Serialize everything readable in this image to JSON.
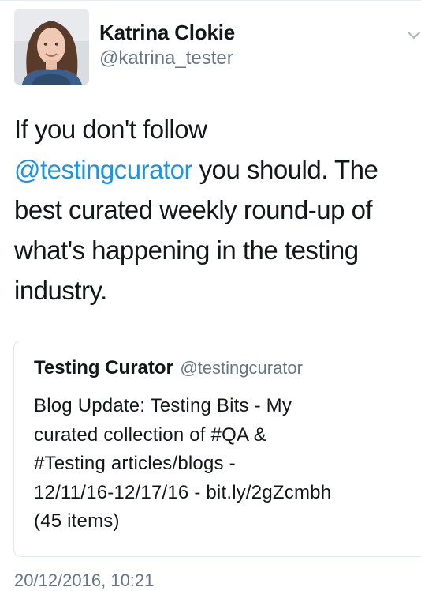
{
  "author": {
    "name": "Katrina Clokie",
    "handle": "@katrina_tester"
  },
  "tweet": {
    "line1": "If you don't follow",
    "mention": "@testingcurator",
    "line2_rest": " you should. The",
    "line3": "best curated weekly round-up of",
    "line4": "what's happening in the testing",
    "line5": "industry."
  },
  "quote": {
    "name": "Testing Curator",
    "handle": "@testingcurator",
    "lines": [
      "Blog Update: Testing Bits - My",
      "curated collection of #QA &",
      "#Testing articles/blogs -",
      "12/11/16-12/17/16 - bit.ly/2gZcmbh",
      "(45 items)"
    ]
  },
  "timestamp": "20/12/2016, 10:21",
  "icons": {
    "more": "chevron-down-icon"
  },
  "colors": {
    "mention": "#1b95e0",
    "secondary_text": "#657786",
    "border": "#e1e8ed"
  }
}
